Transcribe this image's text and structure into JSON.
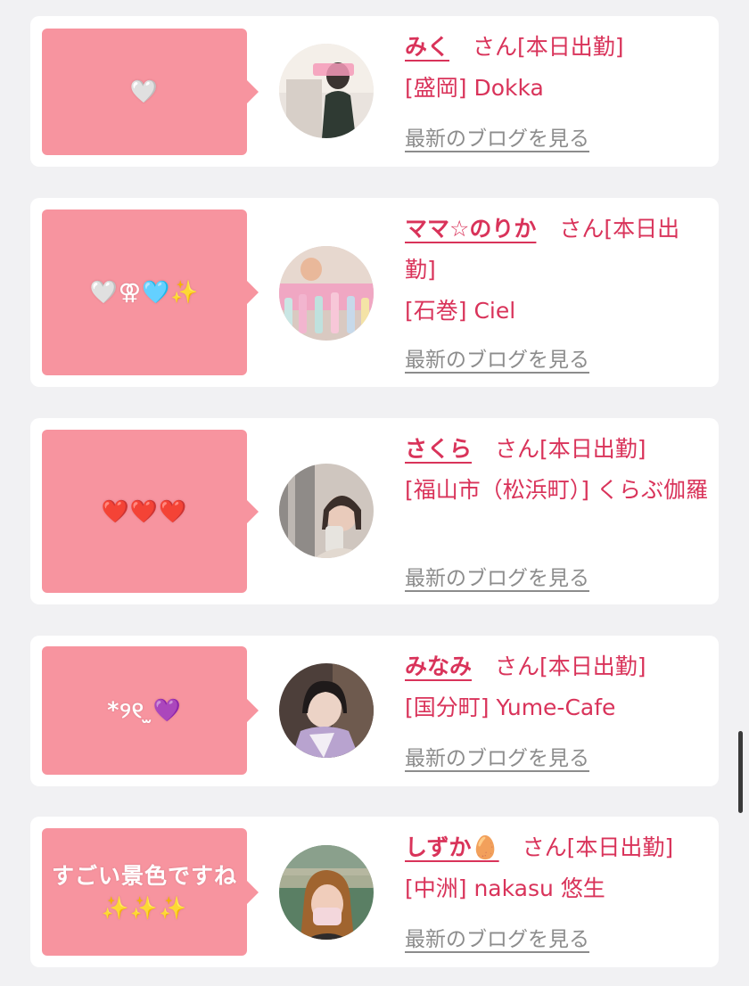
{
  "items": [
    {
      "message": "🤍",
      "name": "みく",
      "suffix": "さん[本日出勤]",
      "shop": "[盛岡] Dokka",
      "blog_link": "最新のブログを見る",
      "avatar_icon": "avatar-photo-miku"
    },
    {
      "message": "🤍⚢🩵✨",
      "name": "ママ☆のりか",
      "suffix": "さん[本日出勤]",
      "shop": "[石巻] Ciel",
      "blog_link": "最新のブログを見る",
      "avatar_icon": "avatar-photo-norika"
    },
    {
      "message": "❤️❤️❤️",
      "name": "さくら",
      "suffix": "さん[本日出勤]",
      "shop": "[福山市（松浜町）] くらぶ伽羅",
      "blog_link": "最新のブログを見る",
      "avatar_icon": "avatar-photo-sakura"
    },
    {
      "message": "*୨୧ ̫💜",
      "name": "みなみ",
      "suffix": "さん[本日出勤]",
      "shop": "[国分町] Yume-Cafe",
      "blog_link": "最新のブログを見る",
      "avatar_icon": "avatar-photo-minami"
    },
    {
      "message": "すごい景色ですね\n✨✨✨",
      "name": "しずか🥚",
      "suffix": "さん[本日出勤]",
      "shop": "[中洲] nakasu 悠生",
      "blog_link": "最新のブログを見る",
      "avatar_icon": "avatar-photo-shizuka"
    }
  ],
  "colors": {
    "background": "#f1f1f3",
    "card": "#ffffff",
    "bubble": "#f7949f",
    "accent": "#d9335a",
    "link_gray": "#8c8c8c"
  }
}
